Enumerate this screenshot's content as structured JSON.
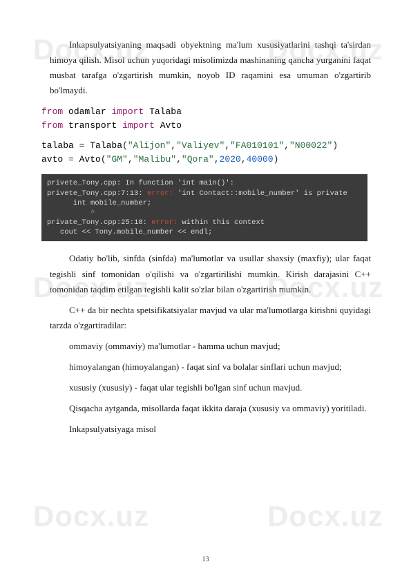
{
  "watermark": "Docx.uz",
  "paragraphs": {
    "p1": "Inkapsulyatsiyaning maqsadi obyektning ma'lum xususiyatlarini tashqi ta'sirdan himoya qilish. Misol uchun yuqoridagi misolimizda mashinaning qancha yurganini faqat musbat tarafga o'zgartirish mumkin, noyob ID raqamini esa umuman o'zgartirib bo'lmaydi.",
    "p2": "Odatiy bo'lib, sinfda (sinfda) ma'lumotlar va usullar shaxsiy (maxfiy); ular faqat tegishli sinf tomonidan o'qilishi va o'zgartirilishi mumkin. Kirish darajasini C++ tomonidan taqdim etilgan tegishli kalit so'zlar bilan o'zgartirish mumkin.",
    "p3": "C++ da bir nechta spetsifikatsiyalar mavjud va ular ma'lumotlarga kirishni quyidagi tarzda o'zgartiradilar:",
    "p4": "ommaviy (ommaviy) ma'lumotlar - hamma uchun mavjud;",
    "p5": "himoyalangan (himoyalangan) - faqat sinf va bolalar sinflari uchun mavjud;",
    "p6": "xususiy (xususiy) - faqat ular tegishli bo'lgan sinf uchun mavjud.",
    "p7": "Qisqacha aytganda, misollarda faqat ikkita daraja (xususiy va ommaviy) yoritiladi.",
    "p8": "Inkapsulyatsiyaga misol"
  },
  "code": {
    "kw_from": "from",
    "kw_import": "import",
    "mod1": "odamlar",
    "cls1": "Talaba",
    "mod2": "transport",
    "cls2": "Avto",
    "var1": "talaba",
    "var2": "avto",
    "call1": "Talaba",
    "call2": "Avto",
    "s1": "\"Alijon\"",
    "s2": "\"Valiyev\"",
    "s3": "\"FA010101\"",
    "s4": "\"N00022\"",
    "s5": "\"GM\"",
    "s6": "\"Malibu\"",
    "s7": "\"Qora\"",
    "n1": "2020",
    "n2": "40000"
  },
  "terminal": {
    "l1a": "privete_Tony.cpp:",
    "l1b": " In function 'int main()':",
    "l2a": "privete_Tony.cpp:7:13: ",
    "l2err": "error:",
    "l2b": " 'int Contact::mobile_number' is private",
    "l3": "      int mobile_number;",
    "l4": "          ^",
    "l5a": "private_Tony.cpp:25:18: ",
    "l5err": "error:",
    "l5b": " within this context",
    "l6": "   cout << Tony.mobile_number << endl;"
  },
  "pagenum": "13"
}
